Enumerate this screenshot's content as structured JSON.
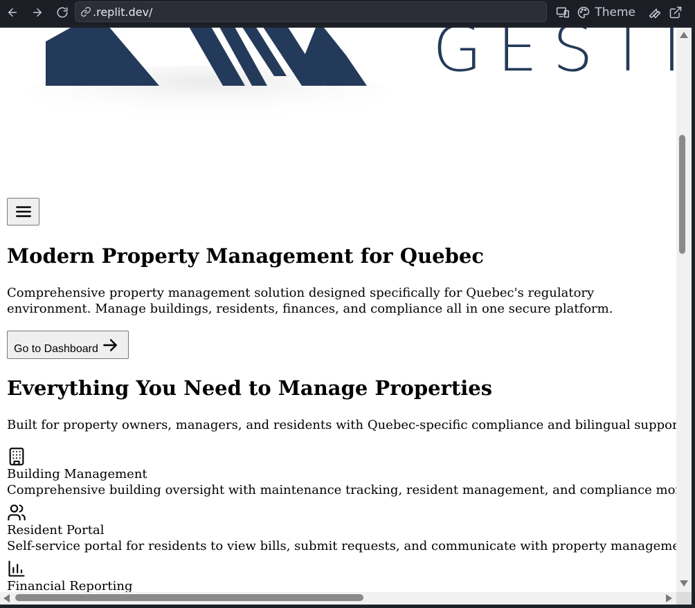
{
  "browser": {
    "url": ".replit.dev/",
    "theme_label": "Theme"
  },
  "logo": {
    "text": "GESTI"
  },
  "hero": {
    "title": "Modern Property Management for Quebec",
    "description": "Comprehensive property management solution designed specifically for Quebec's regulatory environment. Manage buildings, residents, finances, and compliance all in one secure platform.",
    "cta_label": "Go to Dashboard"
  },
  "features_section": {
    "title": "Everything You Need to Manage Properties",
    "description": "Built for property owners, managers, and residents with Quebec-specific compliance and bilingual support.",
    "items": [
      {
        "icon": "building-icon",
        "title": "Building Management",
        "description": "Comprehensive building oversight with maintenance tracking, resident management, and compliance monitoring."
      },
      {
        "icon": "users-icon",
        "title": "Resident Portal",
        "description": "Self-service portal for residents to view bills, submit requests, and communicate with property management."
      },
      {
        "icon": "bar-chart-icon",
        "title": "Financial Reporting",
        "description": ""
      }
    ]
  },
  "colors": {
    "logo_navy": "#243a5a",
    "browser_chrome": "#1c1e26",
    "page_background": "#ffffff"
  }
}
